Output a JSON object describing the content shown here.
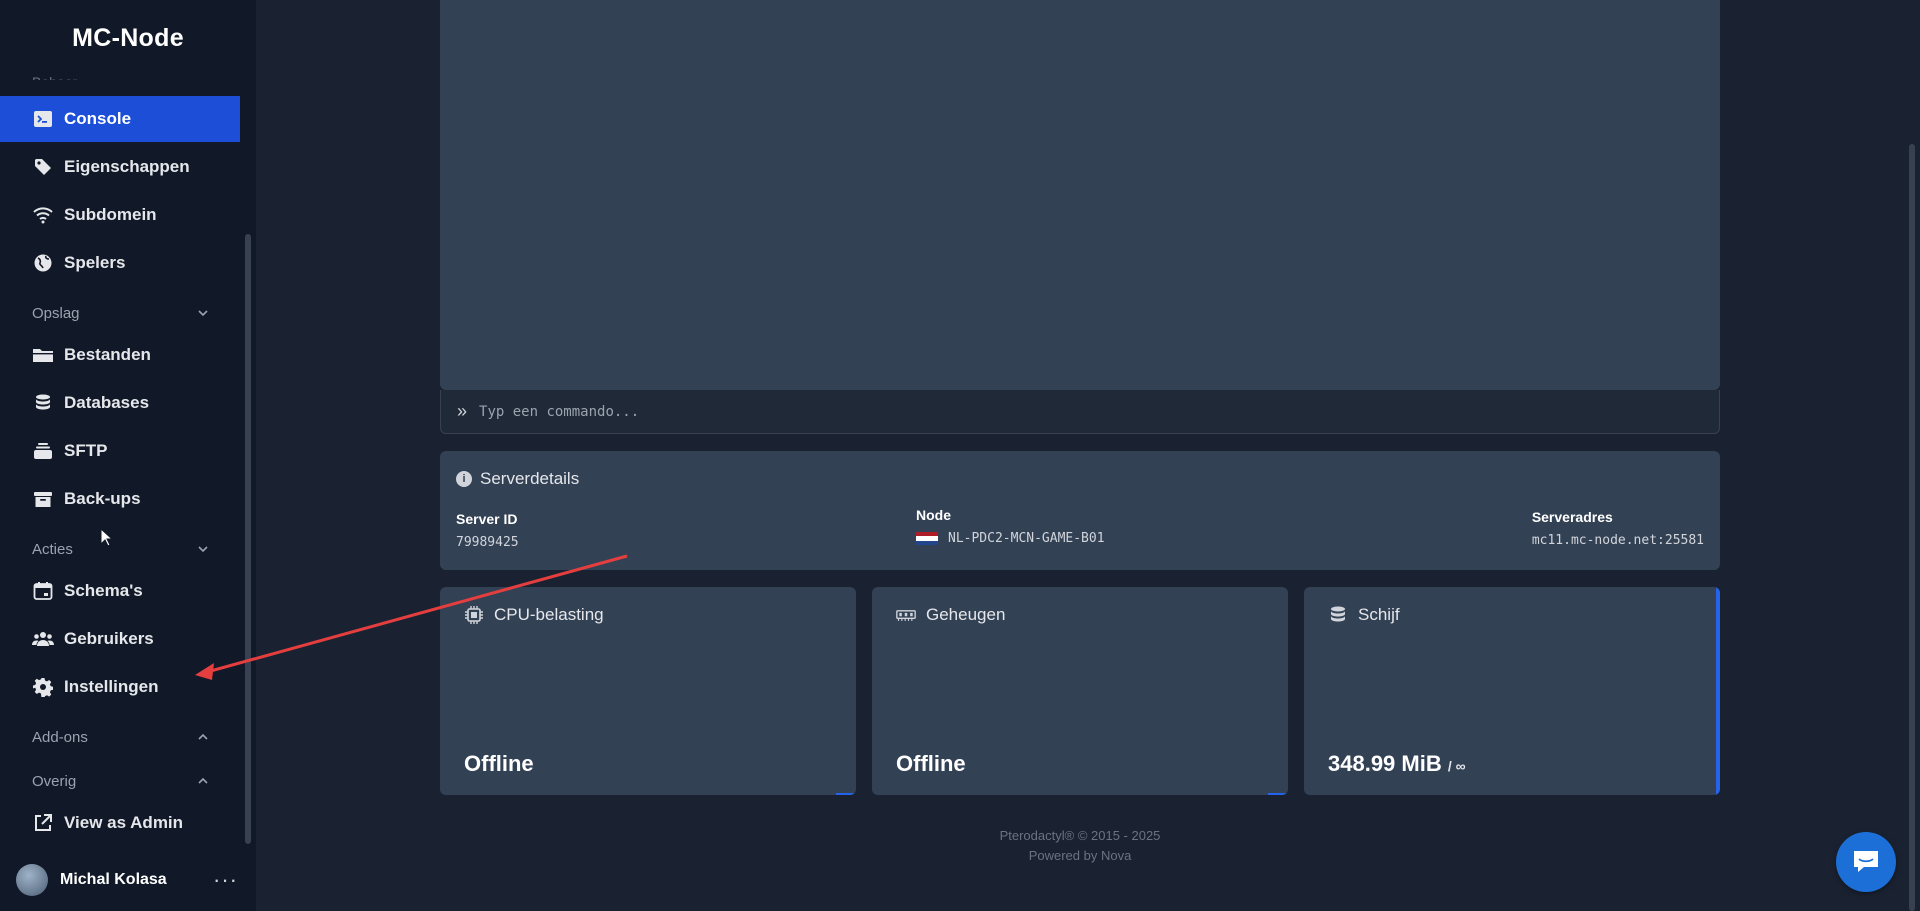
{
  "app": {
    "brand": "MC-Node"
  },
  "sidebar": {
    "section_partial": "Beheer",
    "items_top": [
      {
        "label": "Console",
        "icon": "terminal-icon",
        "active": true
      },
      {
        "label": "Eigenschappen",
        "icon": "tag-icon"
      },
      {
        "label": "Subdomein",
        "icon": "wifi-icon"
      },
      {
        "label": "Spelers",
        "icon": "globe-icon"
      }
    ],
    "group_opslag": {
      "label": "Opslag",
      "icon": "chevron-down-icon"
    },
    "items_opslag": [
      {
        "label": "Bestanden",
        "icon": "folder-icon"
      },
      {
        "label": "Databases",
        "icon": "database-icon"
      },
      {
        "label": "SFTP",
        "icon": "stack-icon"
      },
      {
        "label": "Back-ups",
        "icon": "archive-icon"
      }
    ],
    "group_acties": {
      "label": "Acties",
      "icon": "chevron-down-icon"
    },
    "items_acties": [
      {
        "label": "Schema's",
        "icon": "calendar-icon"
      },
      {
        "label": "Gebruikers",
        "icon": "users-icon"
      },
      {
        "label": "Instellingen",
        "icon": "gear-icon"
      }
    ],
    "group_addons": {
      "label": "Add-ons",
      "icon": "chevron-up-icon"
    },
    "group_overig": {
      "label": "Overig",
      "icon": "chevron-up-icon"
    },
    "items_overig": [
      {
        "label": "View as Admin",
        "icon": "external-link-icon"
      }
    ],
    "user": {
      "name": "Michal Kolasa",
      "more": "···"
    }
  },
  "console": {
    "command_placeholder": "Typ een commando..."
  },
  "server_details": {
    "title": "Serverdetails",
    "server_id_label": "Server ID",
    "server_id": "79989425",
    "node_label": "Node",
    "node": "NL-PDC2-MCN-GAME-B01",
    "address_label": "Serveradres",
    "address": "mc11.mc-node.net:25581"
  },
  "stats": {
    "cpu": {
      "title": "CPU-belasting",
      "value": "Offline"
    },
    "memory": {
      "title": "Geheugen",
      "value": "Offline"
    },
    "disk": {
      "title": "Schijf",
      "value": "348.99 MiB",
      "limit": "/ ∞"
    }
  },
  "footer": {
    "copyright": "Pterodactyl® © 2015 - 2025",
    "powered": "Powered by Nova"
  },
  "colors": {
    "accent": "#1d4ed8",
    "annotation_arrow": "#e53e3e",
    "chat_button": "#1d6fd8"
  }
}
